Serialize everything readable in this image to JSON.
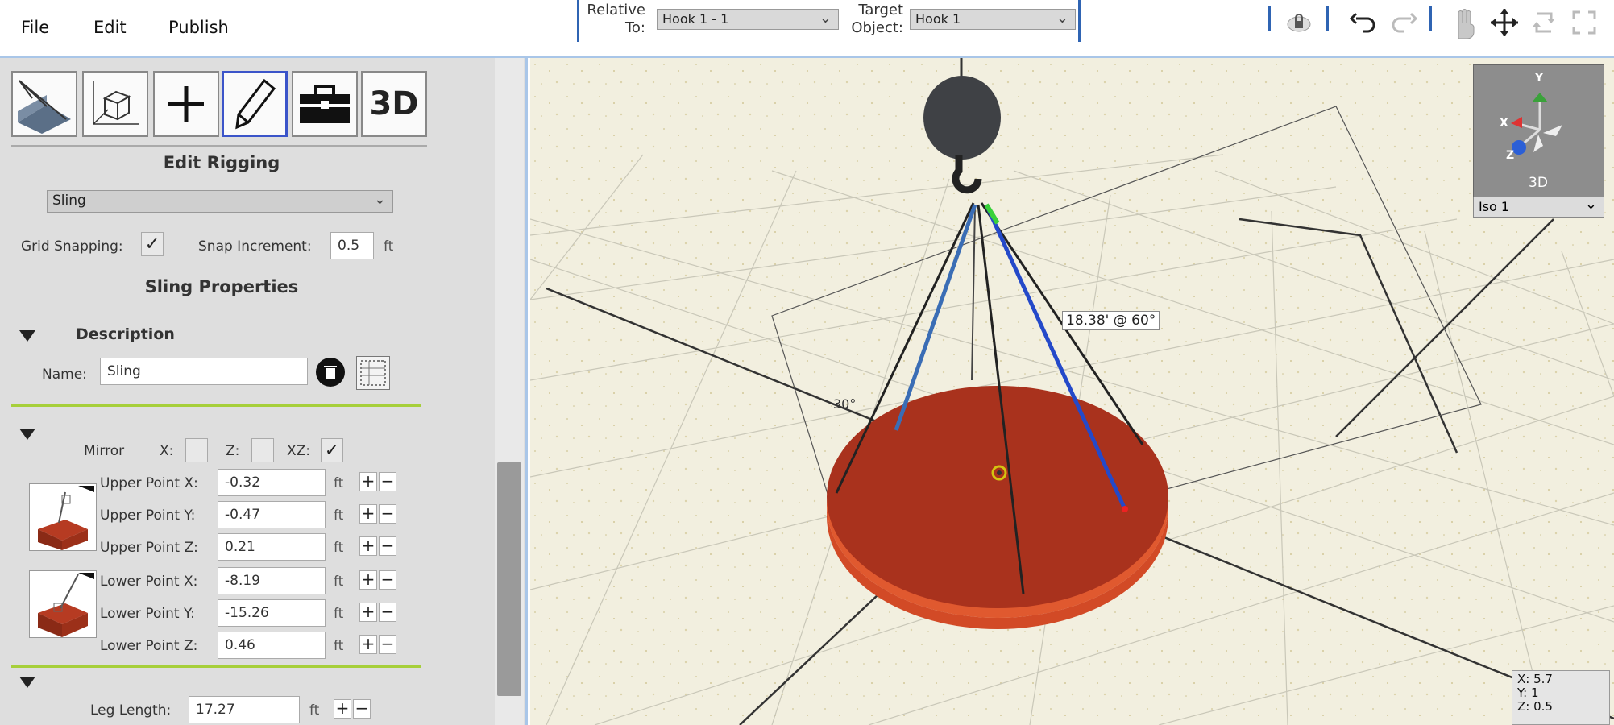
{
  "menu": {
    "file": "File",
    "edit": "Edit",
    "publish": "Publish"
  },
  "relative": {
    "label": "Relative\nTo:",
    "value": "Hook 1 - 1",
    "target_label": "Target\nObject:",
    "target_value": "Hook 1"
  },
  "toolbar_icons": [
    "lock-icon",
    "undo-icon",
    "redo-icon",
    "hand-icon",
    "move-icon",
    "rotate-icon",
    "expand-icon"
  ],
  "tools": {
    "threed_label": "3D"
  },
  "panel": {
    "title": "Edit Rigging",
    "type_select": "Sling",
    "grid_snapping_label": "Grid Snapping:",
    "snap_increment_label": "Snap Increment:",
    "snap_increment_value": "0.5",
    "unit_ft": "ft",
    "section_title": "Sling Properties",
    "description_label": "Description",
    "name_label": "Name:",
    "name_value": "Sling",
    "mirror_label": "Mirror",
    "mirror_x": "X:",
    "mirror_z": "Z:",
    "mirror_xz": "XZ:",
    "upper_x_label": "Upper Point X:",
    "upper_x_value": "-0.32",
    "upper_y_label": "Upper Point Y:",
    "upper_y_value": "-0.47",
    "upper_z_label": "Upper Point Z:",
    "upper_z_value": "0.21",
    "lower_x_label": "Lower Point X:",
    "lower_x_value": "-8.19",
    "lower_y_label": "Lower Point Y:",
    "lower_y_value": "-15.26",
    "lower_z_label": "Lower Point Z:",
    "lower_z_value": "0.46",
    "leg_length_label": "Leg Length:",
    "leg_length_value": "17.27",
    "plus": "+",
    "minus": "−"
  },
  "viewport": {
    "dimension_label": "18.38' @ 60°",
    "angle_label": "30°",
    "navcube": {
      "y": "Y",
      "x": "X",
      "z": "Z",
      "label": "3D"
    },
    "view_select": "Iso 1",
    "coords": {
      "x": "X: 5.7",
      "y": "Y: 1",
      "z": "Z: 0.5"
    }
  },
  "colors": {
    "accent": "#2f64b3",
    "green_separator": "#a6cf3a",
    "load_red": "#a9321d",
    "sling_blue": "#2449c9"
  }
}
